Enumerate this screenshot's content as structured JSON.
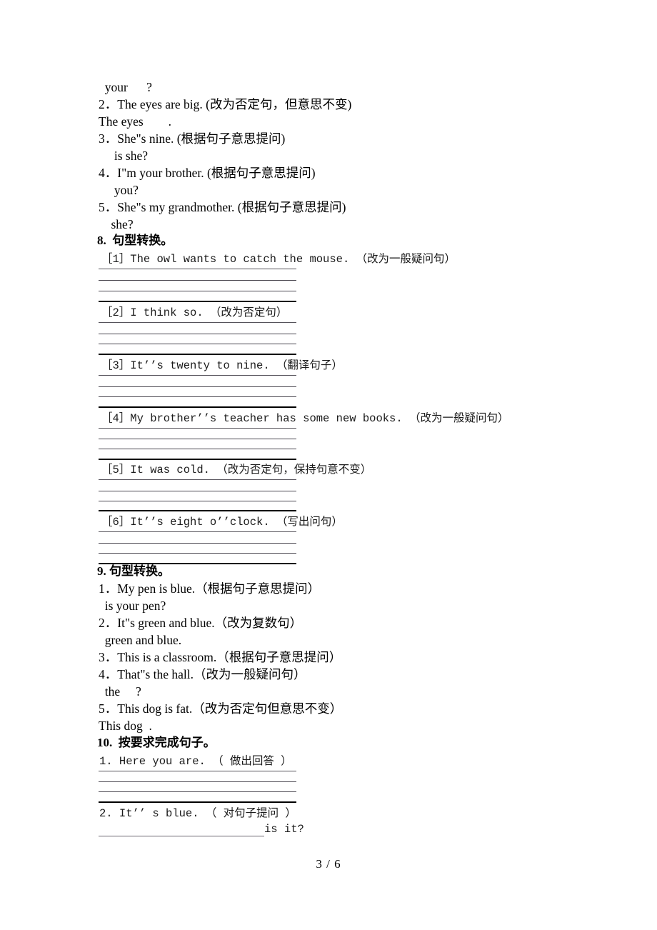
{
  "document": {
    "page_label": "3 / 6"
  },
  "top_block": {
    "lines": [
      "  your      ?",
      "2．The eyes are big. (改为否定句，但意思不变)",
      "The eyes        .",
      "3．She\"s nine. (根据句子意思提问)",
      "     is she?",
      "4．I\"m your brother. (根据句子意思提问)",
      "     you?",
      "5．She\"s my grandmother. (根据句子意思提问)",
      "    she?"
    ]
  },
  "section8": {
    "heading": "8.  句型转换。",
    "items": [
      "［1］The owl wants to catch the mouse. （改为一般疑问句）",
      "［2］I think so. （改为否定句）",
      "［3］It’’s twenty to nine. （翻译句子）",
      "［4］My brother’’s teacher has some new books. （改为一般疑问句）",
      "［5］It was cold. （改为否定句，保持句意不变）",
      "［6］It’’s eight o’’clock. （写出问句）"
    ]
  },
  "section9": {
    "heading": "9. 句型转换。",
    "lines": [
      "1．My pen is blue.（根据句子意思提问）",
      "  is your pen?",
      "2．It\"s green and blue.（改为复数句）",
      "  green and blue.",
      "3．This is a classroom.（根据句子意思提问）",
      "4．That\"s the hall.（改为一般疑问句）",
      "  the     ?",
      "5．This dog is fat.（改为否定句但意思不变）",
      "This dog  ."
    ]
  },
  "section10": {
    "heading": "10.  按要求完成句子。",
    "item1": "1. Here you are. （ 做出回答 ）",
    "item2": "2. It’’ s blue. （ 对句子提问 ）",
    "item2_tail": "is it?"
  }
}
